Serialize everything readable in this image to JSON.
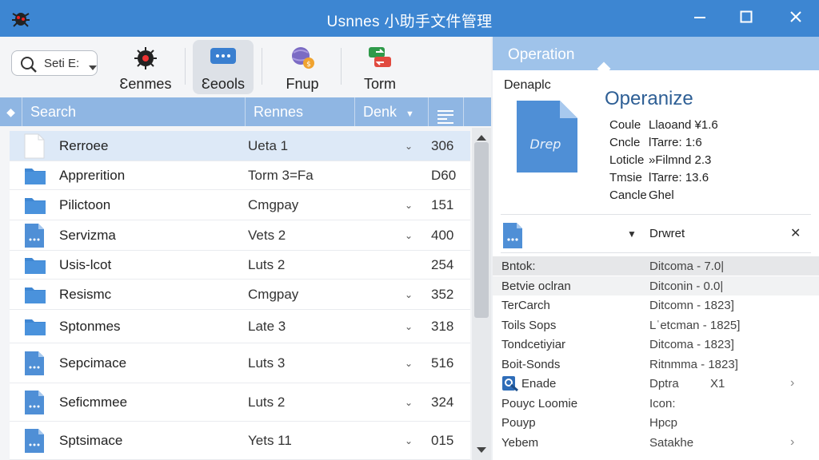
{
  "window": {
    "title": "Usnnes 小助手文件管理",
    "icons": {
      "app": "bug-icon",
      "minimize": "minimize-icon",
      "maximize": "maximize-icon",
      "close": "close-icon"
    }
  },
  "toolbar": {
    "search_text": "Seti E:",
    "buttons": [
      {
        "label": "Ɛenmes",
        "icon": "bug-icon"
      },
      {
        "label": "Ɛeools",
        "icon": "chat-bubble-icon"
      },
      {
        "label": "Fnup",
        "icon": "globe-coin-icon"
      },
      {
        "label": "Torm",
        "icon": "exchange-icon"
      }
    ]
  },
  "table": {
    "headers": {
      "search": "Search",
      "name": "Rennes",
      "date": "Denk"
    },
    "rows": [
      {
        "name": "Rerroee",
        "type": "Ueta 1",
        "chevron": true,
        "size": "306",
        "icon": "blank-file-icon"
      },
      {
        "name": "Apprerition",
        "type": "Torm 3=Fa",
        "chevron": false,
        "size": "D60",
        "icon": "folder-icon"
      },
      {
        "name": "Pilictoon",
        "type": "Cmgpay",
        "chevron": true,
        "size": "151",
        "icon": "folder-icon"
      },
      {
        "name": "Servizma",
        "type": "Vets 2",
        "chevron": true,
        "size": "400",
        "icon": "doc-icon"
      },
      {
        "name": "Usis-lcot",
        "type": "Luts 2",
        "chevron": false,
        "size": "254",
        "icon": "folder-icon"
      },
      {
        "name": "Resismc",
        "type": "Cmgpay",
        "chevron": true,
        "size": "352",
        "icon": "folder-icon"
      },
      {
        "name": "Sptonmes",
        "type": "Late 3",
        "chevron": true,
        "size": "318",
        "icon": "folder-icon"
      },
      {
        "name": "Sepcimace",
        "type": "Luts 3",
        "chevron": true,
        "size": "516",
        "icon": "doc-icon"
      },
      {
        "name": "Seficmmee",
        "type": "Luts 2",
        "chevron": true,
        "size": "324",
        "icon": "doc-icon"
      },
      {
        "name": "Sptsimace",
        "type": "Yets 11",
        "chevron": true,
        "size": "015",
        "icon": "doc-icon"
      }
    ]
  },
  "detail": {
    "header": "Operation",
    "section_label": "Denaplc",
    "doc_icon_text": "Drep",
    "title": "Operanize",
    "props": [
      {
        "k": "Coule",
        "v": "Llaoand ¥1.6"
      },
      {
        "k": "Cncle",
        "v": "lTarre: 1:6"
      },
      {
        "k": "Loticle",
        "v": "»Filmnd 2.3"
      },
      {
        "k": "Tmsie",
        "v": "lTarre: 13.6"
      },
      {
        "k": "Cancle",
        "v": "Ghel"
      }
    ],
    "draft_label": "Drwret",
    "list": [
      {
        "k": "Bntok:",
        "v": "Ditcoma - 7.0|"
      },
      {
        "k": "Betvie oclran",
        "v": "Ditconin - 0.0|"
      },
      {
        "k": "TerCarch",
        "v": "Ditcomn - 1823]"
      },
      {
        "k": "Toils Sops",
        "v": "Lˈetcman - 1825]"
      },
      {
        "k": "Tondcetiyiar",
        "v": "Ditcoma - 1823]"
      },
      {
        "k": "Boit-Sonds",
        "v": "Ritnmma - 1823]"
      },
      {
        "k": "Enade",
        "v": "Dptra",
        "extra": "X1",
        "arrow": "›",
        "icon": "search-doc-icon"
      },
      {
        "k": "Pouyc Loomie",
        "v": "Icon:"
      },
      {
        "k": "Pouyp",
        "v": "Hpcp"
      },
      {
        "k": "Yebem",
        "v": "Satakhe",
        "arrow": "›"
      }
    ]
  }
}
